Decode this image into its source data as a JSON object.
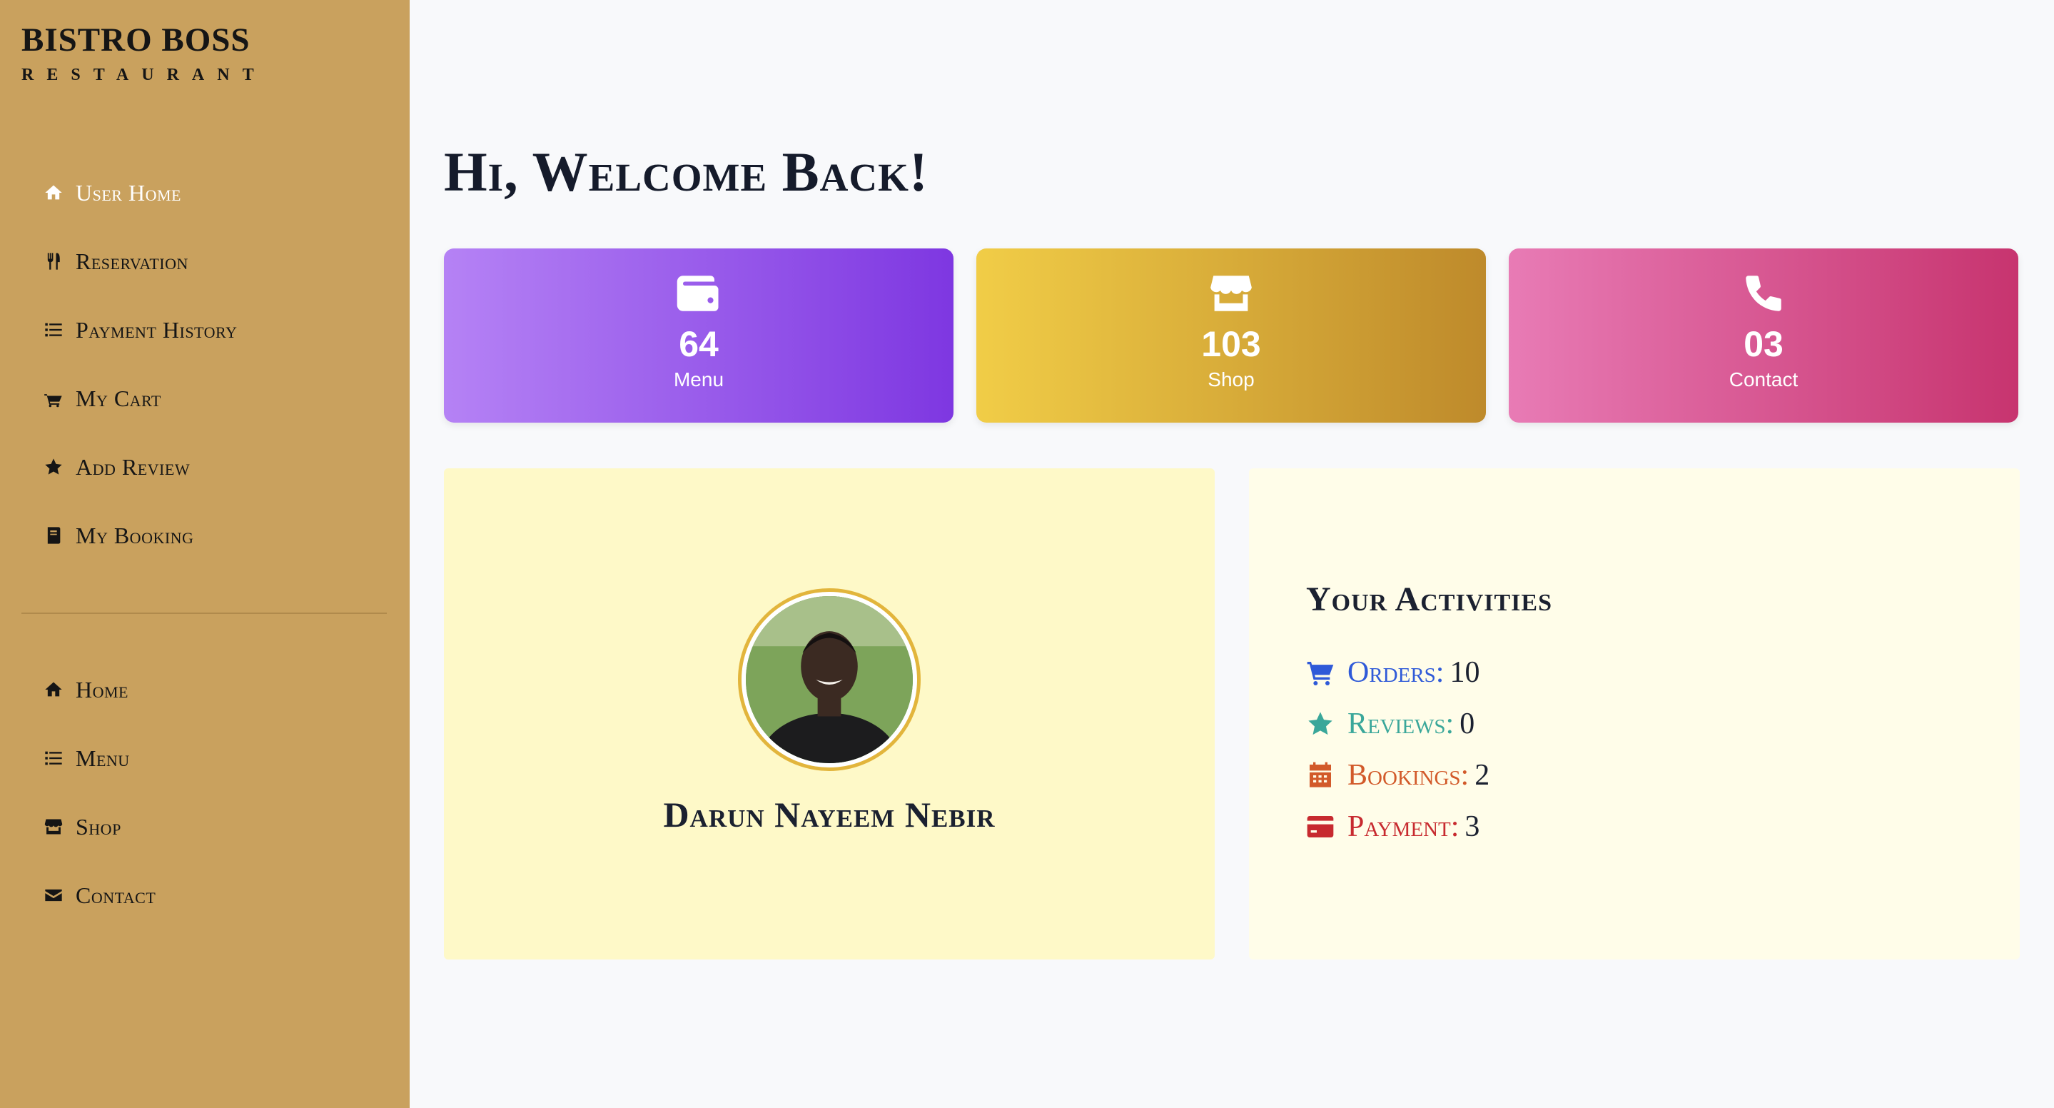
{
  "brand": {
    "title": "BISTRO BOSS",
    "subtitle": "Restaurant"
  },
  "sidebar": {
    "user_items": [
      {
        "label": "User Home",
        "icon": "home-icon",
        "active": true
      },
      {
        "label": "Reservation",
        "icon": "utensils-icon"
      },
      {
        "label": "Payment History",
        "icon": "list-icon"
      },
      {
        "label": "My Cart",
        "icon": "cart-icon"
      },
      {
        "label": "Add Review",
        "icon": "star-icon"
      },
      {
        "label": "My Booking",
        "icon": "book-icon"
      }
    ],
    "site_items": [
      {
        "label": "Home",
        "icon": "home-icon"
      },
      {
        "label": "Menu",
        "icon": "list-icon"
      },
      {
        "label": "Shop",
        "icon": "store-icon"
      },
      {
        "label": "Contact",
        "icon": "envelope-icon"
      }
    ]
  },
  "main": {
    "welcome": "Hi, Welcome Back!",
    "stats": [
      {
        "value": "64",
        "label": "Menu",
        "icon": "wallet-icon"
      },
      {
        "value": "103",
        "label": "Shop",
        "icon": "store-icon"
      },
      {
        "value": "03",
        "label": "Contact",
        "icon": "phone-icon"
      }
    ],
    "profile": {
      "name": "Darun Nayeem Nebir",
      "avatar": "avatar"
    },
    "activities": {
      "title": "Your Activities",
      "items": [
        {
          "label": "Orders:",
          "value": "10",
          "color": "#2f5ad8",
          "icon": "cart-icon"
        },
        {
          "label": "Reviews:",
          "value": "0",
          "color": "#3aa79a",
          "icon": "star-icon"
        },
        {
          "label": "Bookings:",
          "value": "2",
          "color": "#d25a2a",
          "icon": "calendar-icon"
        },
        {
          "label": "Payment:",
          "value": "3",
          "color": "#c72a2f",
          "icon": "credit-card-icon"
        }
      ]
    }
  },
  "colors": {
    "sidebar": "#c9a15e",
    "menu_card": "#7e37e1",
    "shop_card": "#be8a2b",
    "contact_card": "#c7346f"
  }
}
